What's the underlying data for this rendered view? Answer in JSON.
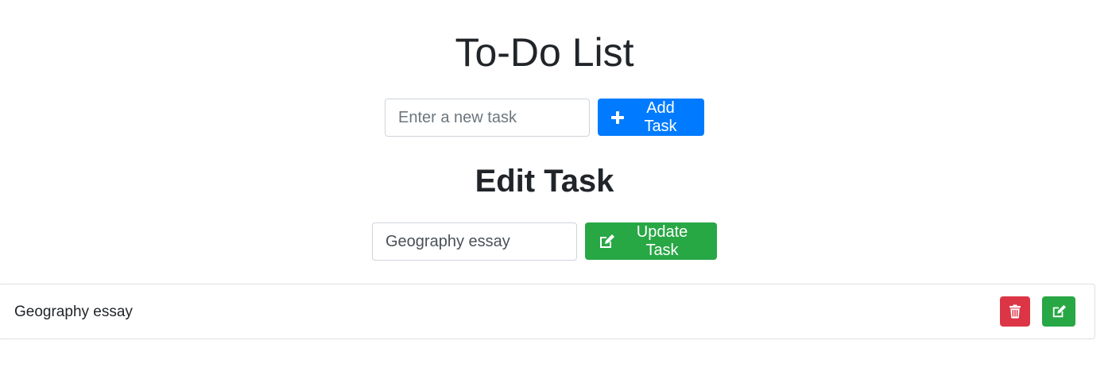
{
  "header": {
    "title": "To-Do List"
  },
  "add_form": {
    "placeholder": "Enter a new task",
    "button_label": "Add Task",
    "button_icon": "plus-icon",
    "accent_color": "#007bff"
  },
  "edit_form": {
    "heading": "Edit Task",
    "value": "Geography essay",
    "button_label": "Update Task",
    "button_icon": "edit-icon",
    "accent_color": "#28a745"
  },
  "tasks": [
    {
      "text": "Geography essay",
      "actions": [
        {
          "icon": "trash-icon",
          "color": "#dc3545"
        },
        {
          "icon": "edit-icon",
          "color": "#28a745"
        }
      ]
    }
  ]
}
